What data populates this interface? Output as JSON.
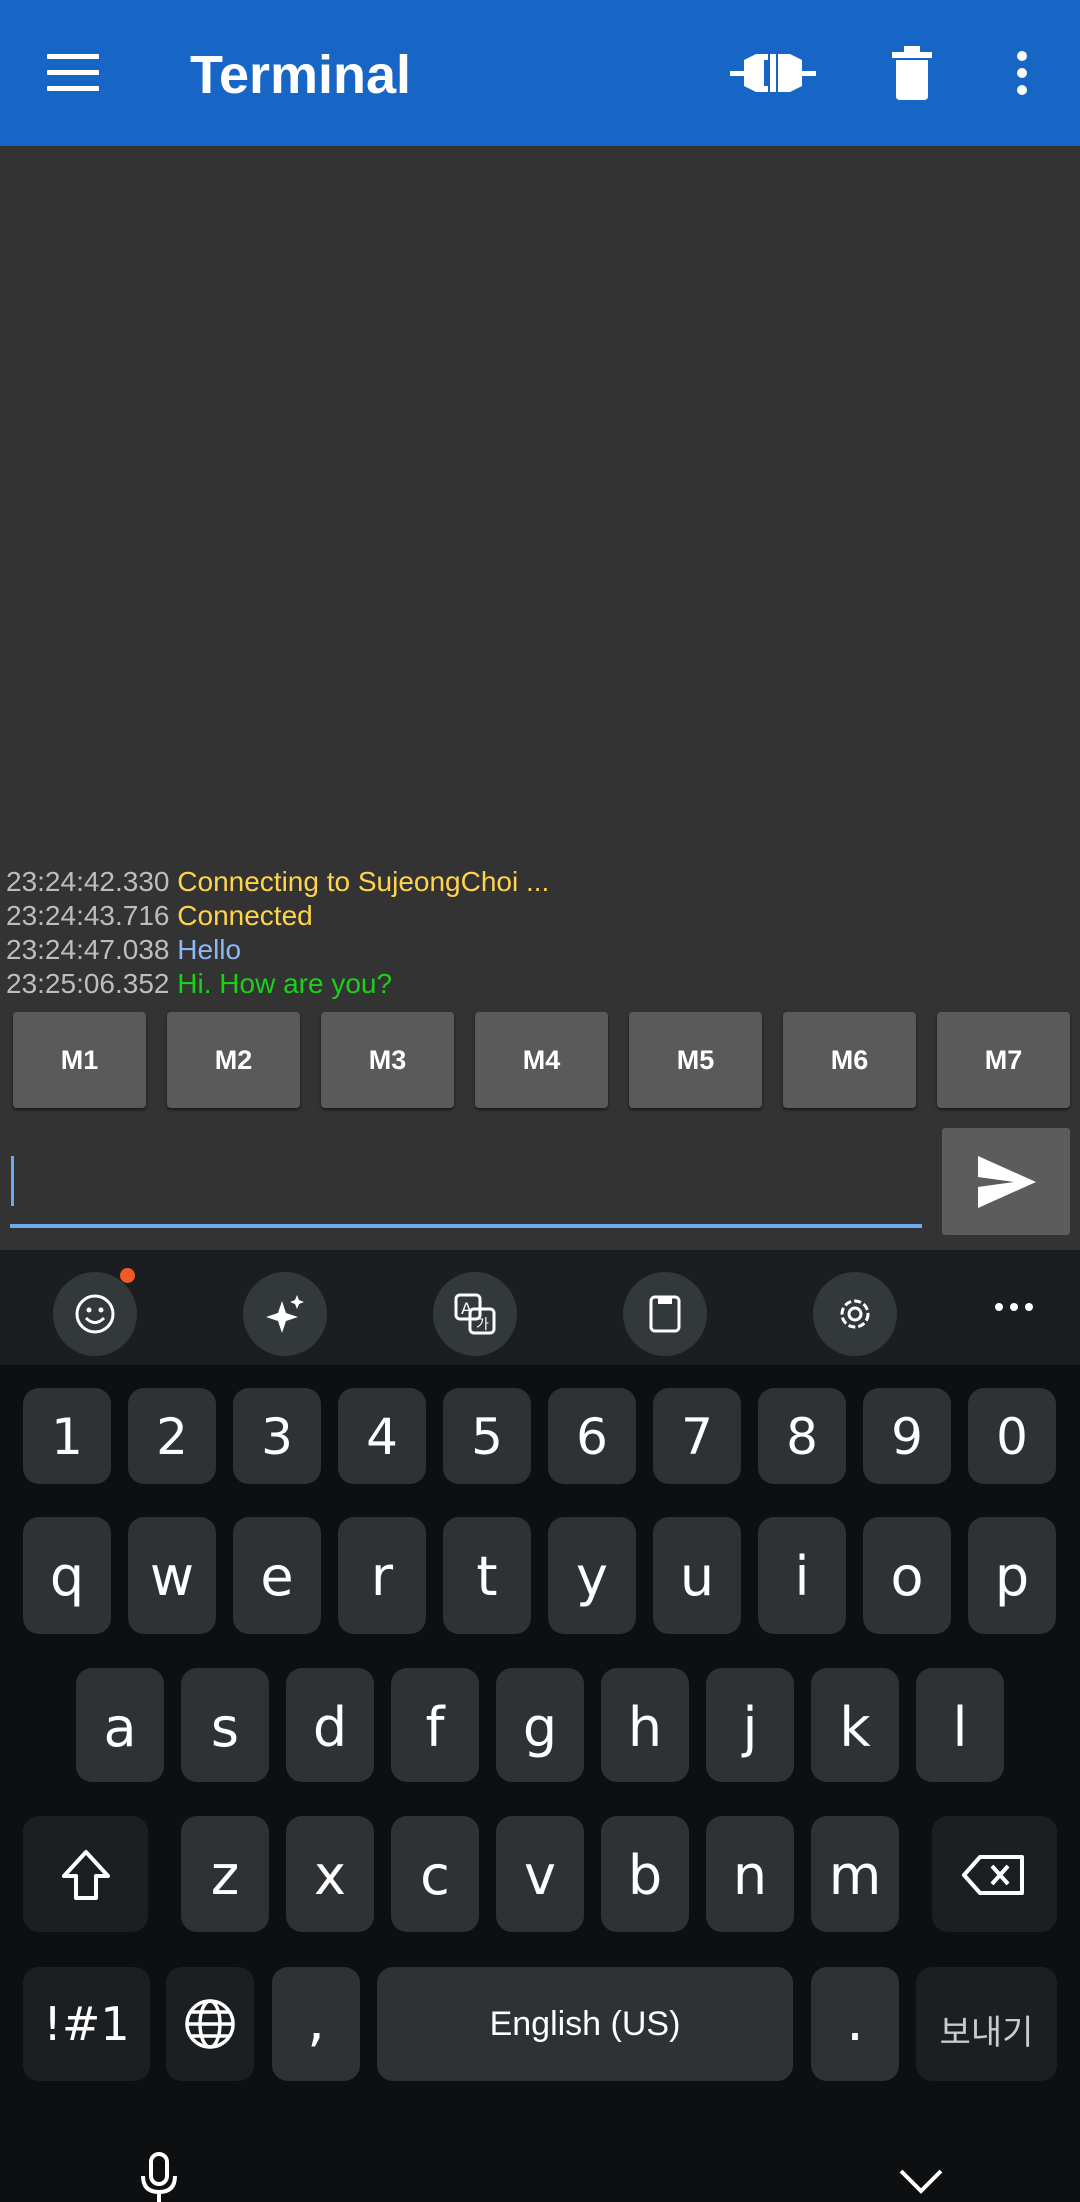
{
  "app_bar": {
    "title": "Terminal",
    "icons": [
      "menu-icon",
      "connect-icon",
      "delete-icon",
      "more-vert-icon"
    ]
  },
  "log": [
    {
      "time": "23:24:42.330",
      "text": "Connecting to SujeongChoi ...",
      "kind": "status"
    },
    {
      "time": "23:24:43.716",
      "text": "Connected",
      "kind": "status"
    },
    {
      "time": "23:24:47.038",
      "text": "Hello",
      "kind": "sent"
    },
    {
      "time": "23:25:06.352",
      "text": "Hi. How are you?",
      "kind": "recv"
    }
  ],
  "macros": [
    "M1",
    "M2",
    "M3",
    "M4",
    "M5",
    "M6",
    "M7"
  ],
  "input": {
    "value": "",
    "placeholder": ""
  },
  "keyboard": {
    "toolbar": [
      "emoji-icon",
      "ai-sparkle-icon",
      "translate-icon",
      "clipboard-icon",
      "settings-icon",
      "more-horiz-icon"
    ],
    "numbers": [
      "1",
      "2",
      "3",
      "4",
      "5",
      "6",
      "7",
      "8",
      "9",
      "0"
    ],
    "row1": [
      "q",
      "w",
      "e",
      "r",
      "t",
      "y",
      "u",
      "i",
      "o",
      "p"
    ],
    "row2": [
      "a",
      "s",
      "d",
      "f",
      "g",
      "h",
      "j",
      "k",
      "l"
    ],
    "row3": [
      "z",
      "x",
      "c",
      "v",
      "b",
      "n",
      "m"
    ],
    "symbols_label": "!#1",
    "comma_label": ",",
    "space_label": "English (US)",
    "period_label": ".",
    "send_label": "보내기"
  },
  "colors": {
    "app_bar": "#1766C6",
    "status_text": "#FFD44A",
    "sent_text": "#8CB8F5",
    "received_text": "#19D119",
    "timestamp": "#BDBDBD"
  }
}
